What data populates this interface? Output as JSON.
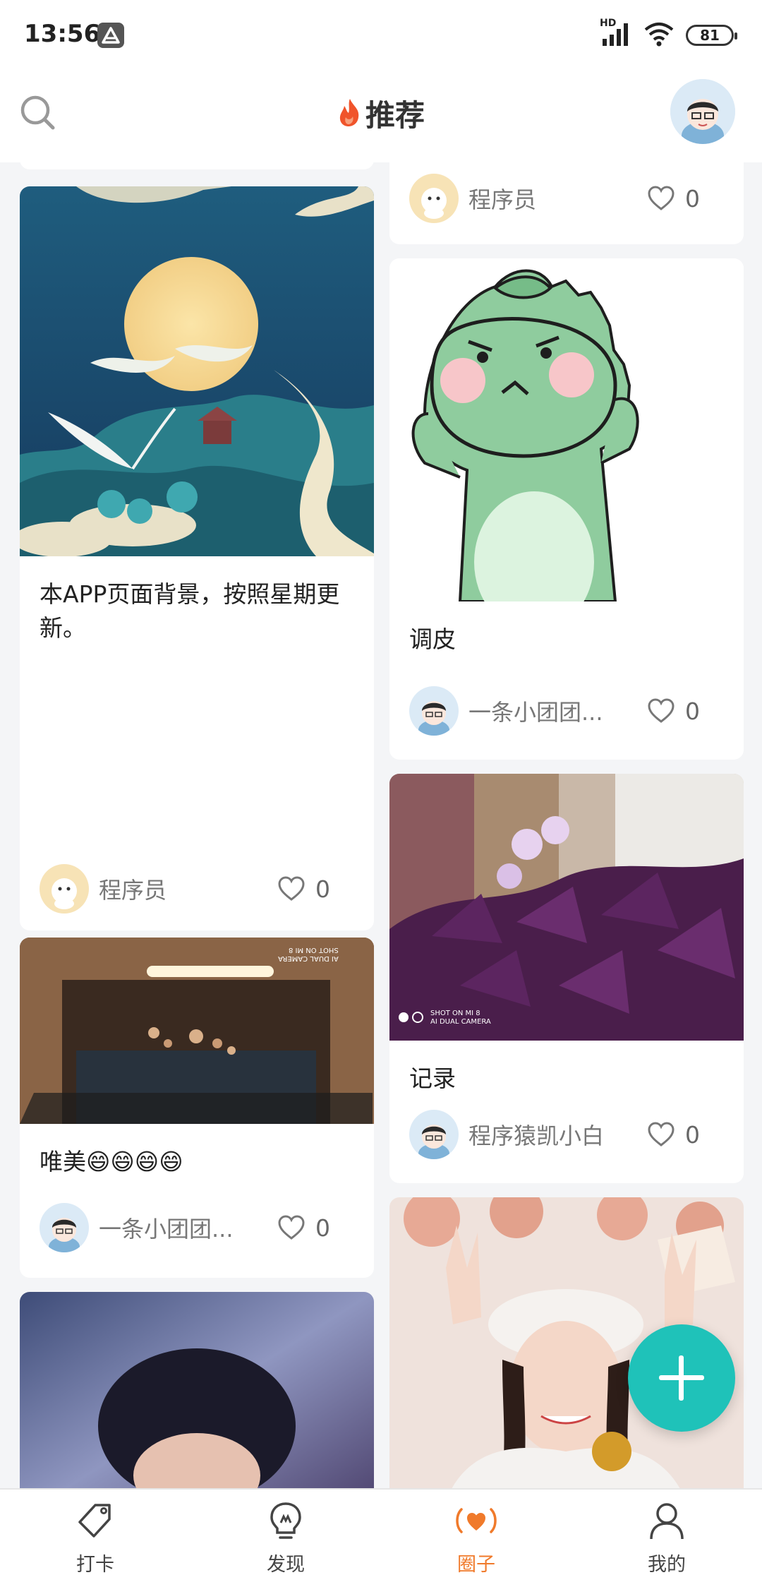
{
  "status_bar": {
    "time": "13:56",
    "network": "HD",
    "battery": "81"
  },
  "header": {
    "title": "推荐",
    "search_icon": "search-icon",
    "avatar": "user-avatar"
  },
  "colors": {
    "accent": "#f07a2b",
    "fab": "#1fc2b9",
    "flame": "#f0542b"
  },
  "feed": {
    "left": [
      {
        "caption": "本APP页面背景，按照星期更新。",
        "author": "程序员",
        "likes": "0",
        "image": "moon-crane-illustration"
      },
      {
        "caption": "唯美😄😄😄😄",
        "author": "一条小团团...",
        "likes": "0",
        "image": "cabinet-water-drops-photo"
      },
      {
        "image": "blurred-portrait-photo"
      }
    ],
    "right": [
      {
        "author": "程序员",
        "likes": "0"
      },
      {
        "caption": "调皮",
        "author": "一条小团团...",
        "likes": "0",
        "image": "green-dinosaur-sticker"
      },
      {
        "caption": "记录",
        "author": "程序猿凯小白",
        "likes": "0",
        "image": "purple-oxalis-photo"
      },
      {
        "image": "girl-peace-sign-photo"
      }
    ],
    "photo_watermark": "SHOT ON MI 8",
    "photo_watermark_2": "AI DUAL CAMERA"
  },
  "fab": {
    "icon": "plus-icon"
  },
  "bottom_nav": [
    {
      "label": "打卡",
      "icon": "tag-icon"
    },
    {
      "label": "发现",
      "icon": "lightbulb-icon"
    },
    {
      "label": "圈子",
      "icon": "heart-signal-icon",
      "active": true
    },
    {
      "label": "我的",
      "icon": "person-icon"
    }
  ]
}
